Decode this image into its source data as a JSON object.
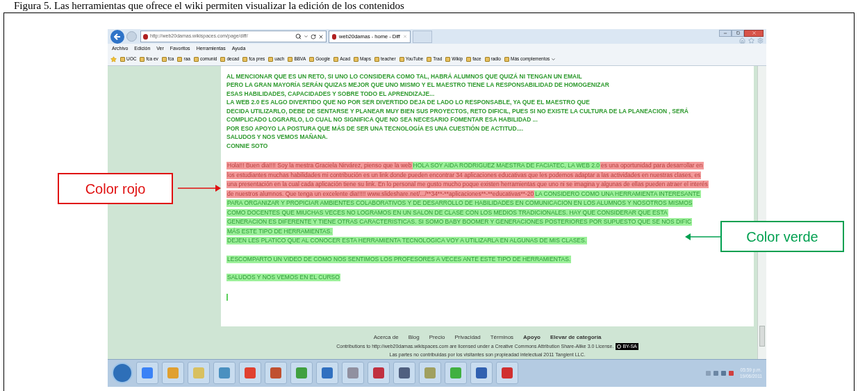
{
  "caption": "Figura 5. Las herramientas que ofrece el wiki permiten visualizar la edición de los contenidos",
  "browser": {
    "address": "http://web20damas.wikispaces.com/page/diff/",
    "tab": {
      "title": "web20damas - home - Diff",
      "selected": true
    },
    "menu": [
      "Archivo",
      "Edición",
      "Ver",
      "Favoritos",
      "Herramientas",
      "Ayuda"
    ],
    "favorites": [
      "UOC",
      "fca ev",
      "fca",
      "raa",
      "comunid",
      "decad",
      "fca pres",
      "uach",
      "BBVA",
      "Google",
      "Acad",
      "Maps",
      "teacher",
      "YouTube",
      "Trad",
      "Wikip",
      "face",
      "radio"
    ],
    "favorites_more": "Más complementos"
  },
  "page": {
    "unchanged_lines": [
      "AL MENCIONAR QUE ES UN RETO, SI UNO LO CONSIDERA COMO TAL, HABRÁ ALUMNOS QUE QUIZÁ NI TENGAN UN EMAIL",
      "PERO LA GRAN MAYORÍA SERÁN QUIZAS MEJOR QUE UNO MISMO Y EL MAESTRO TIENE LA RESPONSABILIDAD DE HOMOGENIZAR",
      "ESAS HABILIDADES, CAPACIDADES Y SOBRE TODO EL APRENDIZAJE...",
      "LA WEB 2.0 ES ALGO DIVERTIDO QUE NO POR SER DIVERTIDO DEJA DE LADO LO RESPONSABLE, YA QUE EL MAESTRO QUE",
      "DECIDA UTILIZARLO, DEBE DE SENTARSE Y PLANEAR MUY BIEN SUS PROYECTOS, RETO DIFICIL, PUES SI NO EXISTE LA CULTURA DE LA PLANEACION , SERÁ",
      "COMPLICADO LOGRARLO, LO CUAL NO SIGNIFICA QUE NO SEA NECESARIO FOMENTAR ESA HABILIDAD ...",
      "POR ESO APOYO LA POSTURA QUE MÁS DE SER UNA TECNOLOGÍA ES UNA CUESTIÓN DE ACTITUD....",
      "SALUDOS Y NOS VEMOS MAÑANA.",
      "CONNIE SOTO"
    ],
    "diff_paragraphs": [
      {
        "lines": [
          {
            "segments": [
              {
                "kind": "deleted",
                "text": "Hola!!! Buen dia!!!! Soy la mestra Graciela Nirvárez, pienso que la web"
              },
              {
                "kind": "inserted",
                "text": "HOLA SOY AIDA RODRIGUEZ MAESTRA DE FACIATEC, LA WEB 2.0"
              },
              {
                "kind": "deleted",
                "text": "es una oportunidad para desarrollar en"
              }
            ]
          },
          {
            "segments": [
              {
                "kind": "deleted",
                "text": "los estudiantes muchas habilidades mi contribución es un link donde pueden encontrar 34 aplicaciones educativas que les podemos adaptar a las actividades en nuestras clases, es"
              }
            ]
          },
          {
            "segments": [
              {
                "kind": "deleted",
                "text": "una presentación en la cual cada aplicación tiene su link. En lo personal me gusto mucho poque existen herramientas que uno ni se imagina y algunas de ellas pueden atraer el interés"
              }
            ]
          },
          {
            "segments": [
              {
                "kind": "deleted",
                "text": "de nuestros alumnos. Que tenga un excelente dia!!!!! www.slideshare.net/.../**34**-**aplicaciones**-**educativas**-20"
              },
              {
                "kind": "inserted",
                "text": "LA CONSIDERO COMO UNA HERRAMIENTA INTERESANTE"
              }
            ]
          },
          {
            "segments": [
              {
                "kind": "inserted",
                "text": "PARA ORGANIZAR Y PROPICIAR AMBIENTES COLABORATIVOS Y DE DESARROLLO DE HABILIDADES EN COMUNICACION EN LOS ALUMNOS Y NOSOTROS MISMOS"
              }
            ]
          },
          {
            "segments": [
              {
                "kind": "inserted",
                "text": "COMO DOCENTES QUE MIUCHAS VECES NO LOGRAMOS EN UN SALON DE CLASE CON LOS MEDIOS TRADICIONALES. HAY QUE CONSIDERAR QUE ESTA"
              }
            ]
          },
          {
            "segments": [
              {
                "kind": "inserted",
                "text": "GENERACION ES DIFERENTE Y TIENE OTRAS CARACTERISTICAS. SI SOMO BABY BOOMER Y GENERACIONES POSTERIORES POR SUPUESTO QUE SE NOS DIFIC"
              }
            ]
          },
          {
            "segments": [
              {
                "kind": "inserted",
                "text": "MÁS ESTE TIPO DE HERRAMIENTAS."
              }
            ]
          },
          {
            "segments": [
              {
                "kind": "inserted",
                "text": "DEJEN LES PLATICO QUE AL CONOCER ESTA HERRAMIENTA TECNOLOGICA VOY A UTILIZARLA EN ALGUNAS DE MIS CLASES."
              }
            ]
          }
        ]
      },
      {
        "lines": [
          {
            "segments": [
              {
                "kind": "inserted",
                "text": "LESCOMPARTO UN VIDEO DE COMO NOS SENTIMOS LOS PROFESORES A VECES ANTE ESTE TIPO DE HERRAMIENTAS."
              }
            ]
          }
        ]
      },
      {
        "lines": [
          {
            "segments": [
              {
                "kind": "inserted",
                "text": "SALUDOS Y NOS VEMOS EN EL CURSO"
              }
            ]
          }
        ]
      }
    ]
  },
  "footer": {
    "links": [
      {
        "text": "Acerca de",
        "bold": false
      },
      {
        "text": "Blog",
        "bold": false
      },
      {
        "text": "Precio",
        "bold": false
      },
      {
        "text": "Privacidad",
        "bold": false
      },
      {
        "text": "Términos",
        "bold": false
      },
      {
        "text": "Apoyo",
        "bold": true
      },
      {
        "text": "Elevar de categoría",
        "bold": true
      }
    ],
    "license": "Contributions to http://web20damas.wikispaces.com are licensed under a Creative Commons Attribution Share-Alike 3.0 License.",
    "badge": "BY-SA",
    "copyright": "Las partes no contribuidas por los visitantes son propieadad intelectual 2011 Tangient LLC."
  },
  "taskbar": {
    "time": "05:59 p.m.",
    "date": "19/06/2011"
  },
  "callouts": [
    {
      "kind": "deleted",
      "text": "Color rojo"
    },
    {
      "kind": "inserted",
      "text": "Color verde"
    }
  ]
}
